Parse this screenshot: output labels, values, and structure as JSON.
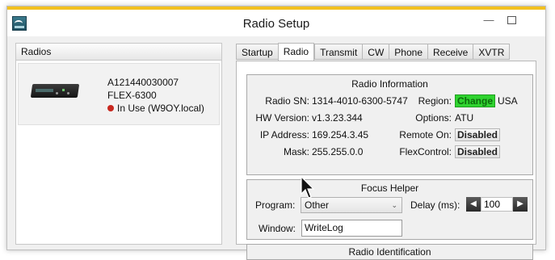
{
  "window": {
    "title": "Radio Setup"
  },
  "radios_panel": {
    "header": "Radios",
    "items": [
      {
        "serial": "A121440030007",
        "model": "FLEX-6300",
        "status": "In Use (W9OY.local)"
      }
    ]
  },
  "tabs": [
    {
      "label": "Startup",
      "active": false
    },
    {
      "label": "Radio",
      "active": true
    },
    {
      "label": "Transmit",
      "active": false
    },
    {
      "label": "CW",
      "active": false
    },
    {
      "label": "Phone",
      "active": false
    },
    {
      "label": "Receive",
      "active": false
    },
    {
      "label": "XVTR",
      "active": false
    }
  ],
  "radio_information": {
    "title": "Radio Information",
    "radio_sn_label": "Radio SN:",
    "radio_sn": "1314-4010-6300-5747",
    "region_label": "Region:",
    "region_button": "Change",
    "region_value": "USA",
    "hw_version_label": "HW Version:",
    "hw_version": "v1.3.23.344",
    "options_label": "Options:",
    "options_value": "ATU",
    "ip_label": "IP Address:",
    "ip_value": "169.254.3.45",
    "remote_on_label": "Remote On:",
    "remote_on_button": "Disabled",
    "mask_label": "Mask:",
    "mask_value": "255.255.0.0",
    "flexcontrol_label": "FlexControl:",
    "flexcontrol_button": "Disabled"
  },
  "focus_helper": {
    "title": "Focus Helper",
    "program_label": "Program:",
    "program_value": "Other",
    "delay_label": "Delay (ms):",
    "delay_value": "100",
    "window_label": "Window:",
    "window_value": "WriteLog"
  },
  "radio_identification": {
    "title": "Radio Identification"
  },
  "colors": {
    "accent": "#f2c01f",
    "status_in_use": "#c8281f",
    "change_button": "#2fd32f"
  }
}
